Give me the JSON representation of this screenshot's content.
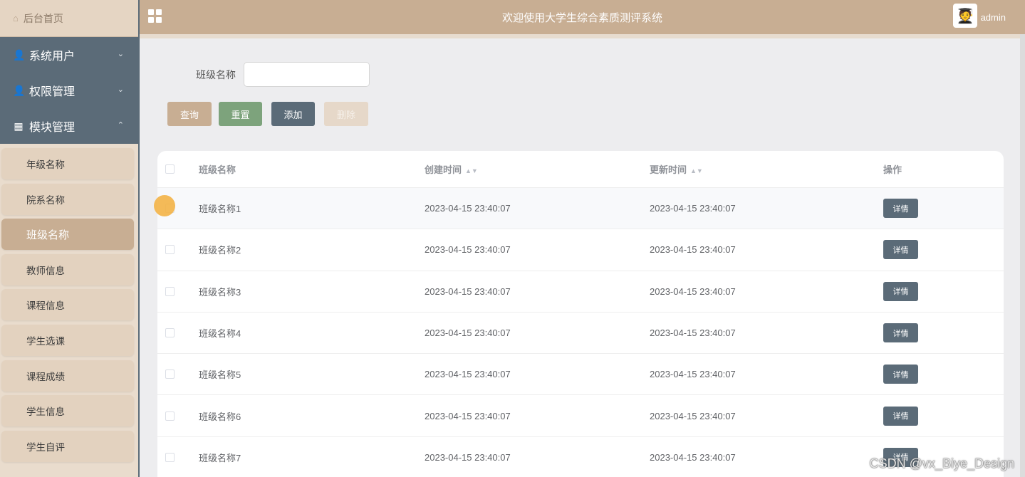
{
  "sidebar": {
    "home": "后台首页",
    "menu": [
      {
        "label": "系统用户",
        "icon": "user-icon",
        "chevron": "⌄"
      },
      {
        "label": "权限管理",
        "icon": "user-icon",
        "chevron": "⌄"
      },
      {
        "label": "模块管理",
        "icon": "grid-icon",
        "chevron": "⌃"
      }
    ],
    "submenu": [
      "年级名称",
      "院系名称",
      "班级名称",
      "教师信息",
      "课程信息",
      "学生选课",
      "课程成绩",
      "学生信息",
      "学生自评"
    ],
    "active": "班级名称"
  },
  "header": {
    "title": "欢迎使用大学生综合素质测评系统",
    "user": "admin"
  },
  "search": {
    "label": "班级名称",
    "value": ""
  },
  "buttons": {
    "query": "查询",
    "reset": "重置",
    "add": "添加",
    "delete": "删除"
  },
  "table": {
    "headers": {
      "name": "班级名称",
      "created": "创建时间",
      "updated": "更新时间",
      "op": "操作"
    },
    "rows": [
      {
        "name": "班级名称1",
        "created": "2023-04-15 23:40:07",
        "updated": "2023-04-15 23:40:07",
        "op": "详情"
      },
      {
        "name": "班级名称2",
        "created": "2023-04-15 23:40:07",
        "updated": "2023-04-15 23:40:07",
        "op": "详情"
      },
      {
        "name": "班级名称3",
        "created": "2023-04-15 23:40:07",
        "updated": "2023-04-15 23:40:07",
        "op": "详情"
      },
      {
        "name": "班级名称4",
        "created": "2023-04-15 23:40:07",
        "updated": "2023-04-15 23:40:07",
        "op": "详情"
      },
      {
        "name": "班级名称5",
        "created": "2023-04-15 23:40:07",
        "updated": "2023-04-15 23:40:07",
        "op": "详情"
      },
      {
        "name": "班级名称6",
        "created": "2023-04-15 23:40:07",
        "updated": "2023-04-15 23:40:07",
        "op": "详情"
      },
      {
        "name": "班级名称7",
        "created": "2023-04-15 23:40:07",
        "updated": "2023-04-15 23:40:07",
        "op": "详情"
      }
    ]
  },
  "watermark": "CSDN @vx_Biye_Design",
  "colors": {
    "sidebar_dark": "#5b6b78",
    "accent_tan": "#c8ae93",
    "reset_green": "#7da37c",
    "sub_bg": "#e3d2bf"
  }
}
